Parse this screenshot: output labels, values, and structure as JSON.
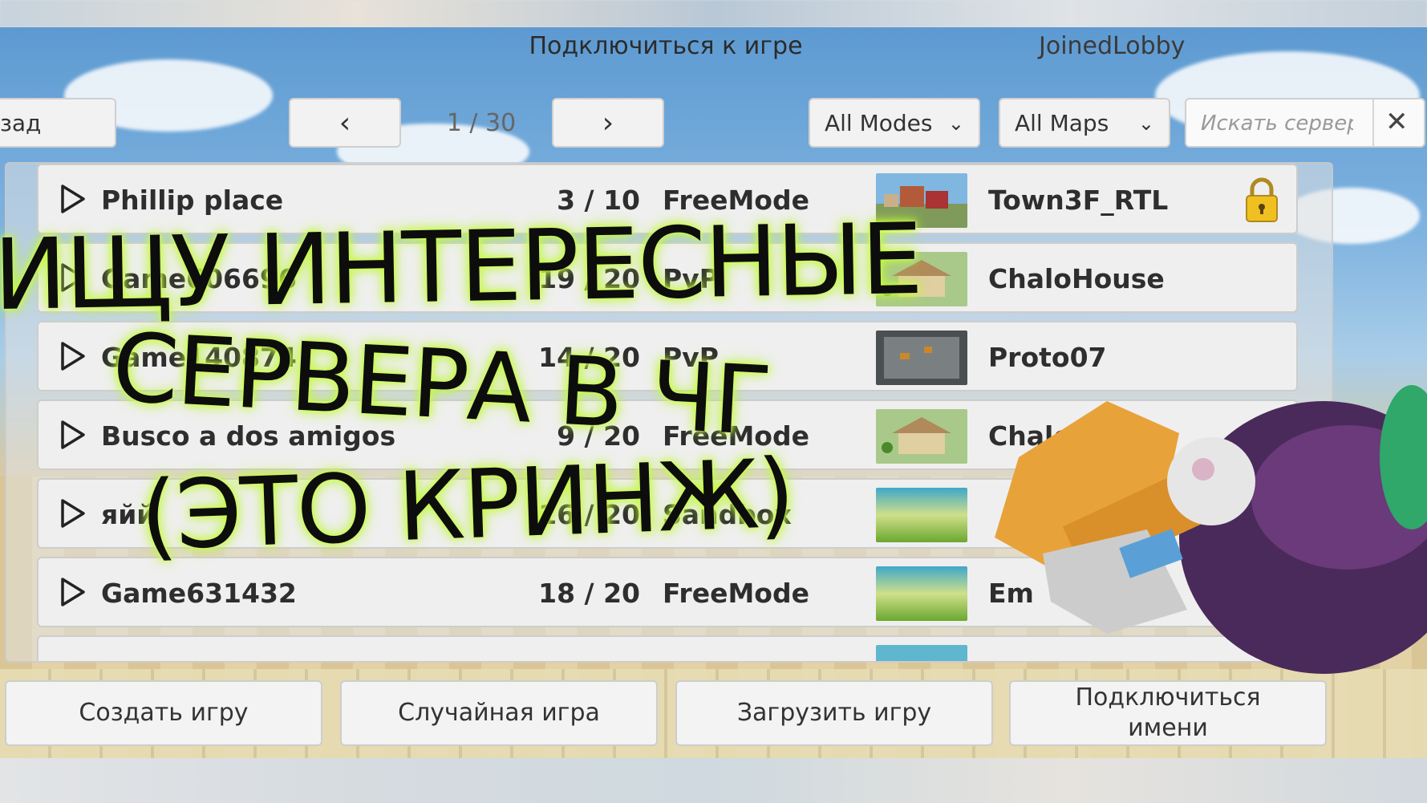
{
  "header": {
    "title": "Подключиться к игре",
    "lobby_status": "JoinedLobby",
    "back_label": "зад",
    "prev_icon": "‹",
    "next_icon": "›",
    "page_indicator": "1 / 30"
  },
  "filters": {
    "modes": {
      "selected": "All Modes"
    },
    "maps": {
      "selected": "All Maps"
    },
    "search": {
      "placeholder": "Искать сервер",
      "value": ""
    }
  },
  "servers": [
    {
      "name": "Phillip place",
      "players": "3 / 10",
      "mode": "FreeMode",
      "map": "Town3F_RTL",
      "locked": true
    },
    {
      "name": "Game606696",
      "players": "19 / 20",
      "mode": "PvP",
      "map": "ChaloHouse",
      "locked": false
    },
    {
      "name": "Game140874",
      "players": "14 / 20",
      "mode": "PvP",
      "map": "Proto07",
      "locked": false
    },
    {
      "name": "Busco a dos amigos",
      "players": "9 / 20",
      "mode": "FreeMode",
      "map": "ChaloHouse",
      "locked": false
    },
    {
      "name": "яйй",
      "players": "16 / 20",
      "mode": "Sandbox",
      "map": "",
      "locked": false
    },
    {
      "name": "Game631432",
      "players": "18 / 20",
      "mode": "FreeMode",
      "map": "Em",
      "locked": false
    }
  ],
  "footer": {
    "create_label": "Создать игру",
    "random_label": "Случайная игра",
    "load_label": "Загрузить  игру",
    "connect_by_name_label": "Подключиться\nимени"
  },
  "overlay": {
    "line1": "ИЩУ ИНТЕРЕСНЫЕ",
    "line2": "СЕРВЕРА В ЧГ",
    "line3": "(ЭТО КРИНЖ)"
  },
  "colors": {
    "overlay_glow": "#c9ff3a",
    "lock_gold": "#f0c020",
    "panel_row": "#efefef"
  }
}
